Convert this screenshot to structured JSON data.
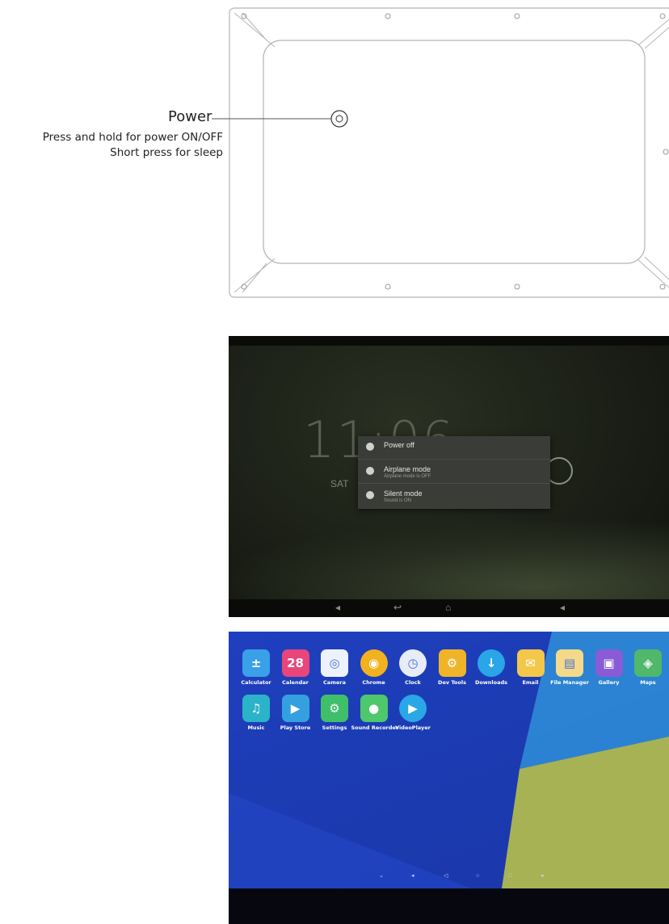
{
  "diagram": {
    "power_label": "Power",
    "power_note_line1": "Press and hold for power ON/OFF",
    "power_note_line2": "Short press for sleep"
  },
  "lockscreen": {
    "clock": "11:06",
    "day": "SAT",
    "power_menu": [
      {
        "title": "Power off",
        "subtitle": ""
      },
      {
        "title": "Airplane mode",
        "subtitle": "Airplane mode is OFF"
      },
      {
        "title": "Silent mode",
        "subtitle": "Sound is ON"
      }
    ]
  },
  "app_drawer": {
    "row1": [
      {
        "label": "Calculator",
        "glyph": "±",
        "color": "#3aa0e8"
      },
      {
        "label": "Calendar",
        "glyph": "28",
        "color": "#e8457a"
      },
      {
        "label": "Camera",
        "glyph": "◎",
        "color": "#eef2ff"
      },
      {
        "label": "Chrome",
        "glyph": "◉",
        "color": "#f2b21f"
      },
      {
        "label": "Clock",
        "glyph": "◷",
        "color": "#e7ecf7"
      },
      {
        "label": "Dev Tools",
        "glyph": "⚙",
        "color": "#f0b429"
      },
      {
        "label": "Downloads",
        "glyph": "↓",
        "color": "#29a5e8"
      },
      {
        "label": "Email",
        "glyph": "✉",
        "color": "#f3c74a"
      },
      {
        "label": "File Manager",
        "glyph": "▤",
        "color": "#f4d98a"
      },
      {
        "label": "Gallery",
        "glyph": "▣",
        "color": "#8a5bd6"
      },
      {
        "label": "Maps",
        "glyph": "◈",
        "color": "#4fb86a"
      }
    ],
    "row2": [
      {
        "label": "Music",
        "glyph": "♫",
        "color": "#2bb4c9"
      },
      {
        "label": "Play Store",
        "glyph": "▶",
        "color": "#35a0e0"
      },
      {
        "label": "Settings",
        "glyph": "⚙",
        "color": "#3fbf6a"
      },
      {
        "label": "Sound Recorder",
        "glyph": "●",
        "color": "#4fc86b"
      },
      {
        "label": "VideoPlayer",
        "glyph": "▶",
        "color": "#2aa7e6"
      }
    ]
  }
}
